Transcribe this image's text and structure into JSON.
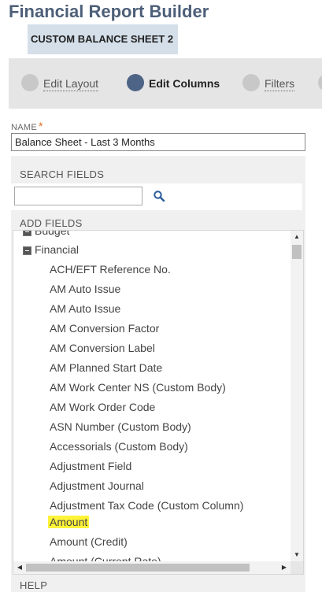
{
  "header": {
    "title": "Financial Report Builder",
    "report_name": "CUSTOM BALANCE SHEET 2"
  },
  "wizard": {
    "steps": [
      {
        "label": "Edit Layout",
        "state": "link",
        "color": "#c8c8c8"
      },
      {
        "label": "Edit Columns",
        "state": "active",
        "color": "#4e6486"
      },
      {
        "label": "Filters",
        "state": "link",
        "color": "#c8c8c8"
      }
    ]
  },
  "form": {
    "name_label": "NAME",
    "required_mark": "*",
    "name_value": "Balance Sheet - Last 3 Months",
    "search_fields_label": "SEARCH FIELDS",
    "search_value": "",
    "add_fields_label": "ADD FIELDS",
    "help_label": "HELP"
  },
  "tree": {
    "partial_top": "Budget",
    "group": "Financial",
    "highlighted": "Amount",
    "items": [
      "ACH/EFT Reference No.",
      "AM Auto Issue",
      "AM Auto Issue",
      "AM Conversion Factor",
      "AM Conversion Label",
      "AM Planned Start Date",
      "AM Work Center NS (Custom Body)",
      "AM Work Order Code",
      "ASN Number (Custom Body)",
      "Accessorials (Custom Body)",
      "Adjustment Field",
      "Adjustment Journal",
      "Adjustment Tax Code (Custom Column)",
      "Amount",
      "Amount (Credit)",
      "Amount (Current Rate)"
    ]
  },
  "colors": {
    "title": "#4d5f79",
    "subtitle_bg": "#d5dfe9",
    "active_step": "#4e6486",
    "inactive_step": "#c8c8c8",
    "highlight": "#fff338",
    "required": "#e06a1c"
  },
  "icons": {
    "search": "magnifier-icon",
    "collapse": "minus-square-icon"
  }
}
